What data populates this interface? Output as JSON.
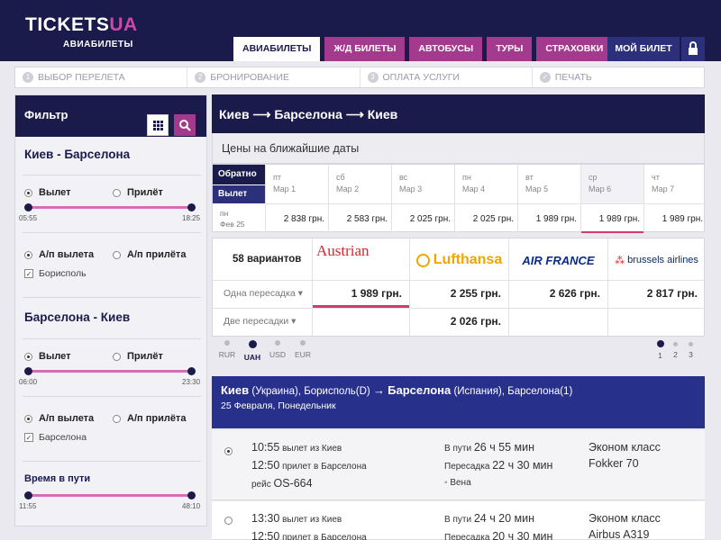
{
  "brand": {
    "logo_main": "TICKETS",
    "logo_accent": "UA",
    "subtitle": "АВИАБИЛЕТЫ"
  },
  "nav": {
    "tabs": [
      "АВИАБИЛЕТЫ",
      "Ж/Д БИЛЕТЫ",
      "АВТОБУСЫ",
      "ТУРЫ",
      "СТРАХОВКИ"
    ],
    "my_ticket": "МОЙ БИЛЕТ"
  },
  "steps": [
    {
      "num": "1",
      "label": "ВЫБОР ПЕРЕЛЕТА"
    },
    {
      "num": "2",
      "label": "БРОНИРОВАНИЕ"
    },
    {
      "num": "3",
      "label": "ОПЛАТА УСЛУГИ"
    },
    {
      "num": "✓",
      "label": "ПЕЧАТЬ"
    }
  ],
  "filter": {
    "title": "Фильтр",
    "outbound": {
      "title": "Киев - Барселона",
      "depart": "Вылет",
      "arrive": "Прилёт",
      "time_from": "05:55",
      "time_to": "18:25",
      "airport_dep": "А/п вылета",
      "airport_arr": "А/п прилёта",
      "airport_checked": "Борисполь"
    },
    "return": {
      "title": "Барселона - Киев",
      "depart": "Вылет",
      "arrive": "Прилёт",
      "time_from": "06:00",
      "time_to": "23:30",
      "airport_dep": "А/п вылета",
      "airport_arr": "А/п прилёта",
      "airport_checked": "Барселона"
    },
    "duration": {
      "title": "Время в пути",
      "from": "11:55",
      "to": "48:10"
    }
  },
  "main": {
    "route_title": "Киев ⟶ Барселона ⟶ Киев",
    "prices_title": "Цены на ближайшие даты",
    "label_back": "Обратно",
    "label_out": "Вылет",
    "ret_day": "пн",
    "ret_date": "Фев 25",
    "dates": [
      {
        "day": "пт",
        "date": "Мар 1",
        "price": "2 838 грн."
      },
      {
        "day": "сб",
        "date": "Мар 2",
        "price": "2 583 грн."
      },
      {
        "day": "вс",
        "date": "Мар 3",
        "price": "2 025 грн."
      },
      {
        "day": "пн",
        "date": "Мар 4",
        "price": "2 025 грн."
      },
      {
        "day": "вт",
        "date": "Мар 5",
        "price": "1 989 грн."
      },
      {
        "day": "ср",
        "date": "Мар 6",
        "price": "1 989 грн."
      },
      {
        "day": "чт",
        "date": "Мар 7",
        "price": "1 989 грн."
      }
    ],
    "variants": "58 вариантов",
    "row_one_stop": "Одна пересадка",
    "row_two_stops": "Две пересадки",
    "airlines": [
      {
        "name": "Austrian",
        "one_stop": "1 989 грн.",
        "two_stops": ""
      },
      {
        "name": "Lufthansa",
        "one_stop": "2 255 грн.",
        "two_stops": "2 026 грн."
      },
      {
        "name": "AIR FRANCE",
        "one_stop": "2 626 грн.",
        "two_stops": ""
      },
      {
        "name": "brussels airlines",
        "one_stop": "2 817 грн.",
        "two_stops": ""
      }
    ],
    "currencies": [
      "RUR",
      "UAH",
      "USD",
      "EUR"
    ],
    "pages": [
      "1",
      "2",
      "3"
    ],
    "segment": {
      "from_city": "Киев",
      "from_detail": "(Украина), Борисполь(D)",
      "arrow": "→",
      "to_city": "Барселона",
      "to_detail": "(Испания), Барселона(1)",
      "date": "25 Февраля, Понедельник"
    },
    "flights": [
      {
        "dep_time": "10:55",
        "dep_text": "вылет из Киев",
        "arr_time": "12:50",
        "arr_text": "прилет в Барселона",
        "flight_label": "рейс",
        "flight_no": "OS-664",
        "duration_label": "В пути",
        "duration": "26 ч 55 мин",
        "transfer_label": "Пересадка",
        "transfer": "22 ч 30 мин",
        "transfer_city": "Вена",
        "class": "Эконом класс",
        "aircraft": "Fokker 70"
      },
      {
        "dep_time": "13:30",
        "dep_text": "вылет из Киев",
        "arr_time": "12:50",
        "arr_text": "прилет в Барселона",
        "duration_label": "В пути",
        "duration": "24 ч 20 мин",
        "transfer_label": "Пересадка",
        "transfer": "20 ч 30 мин",
        "class": "Эконом класс",
        "aircraft": "Airbus A319"
      }
    ]
  }
}
